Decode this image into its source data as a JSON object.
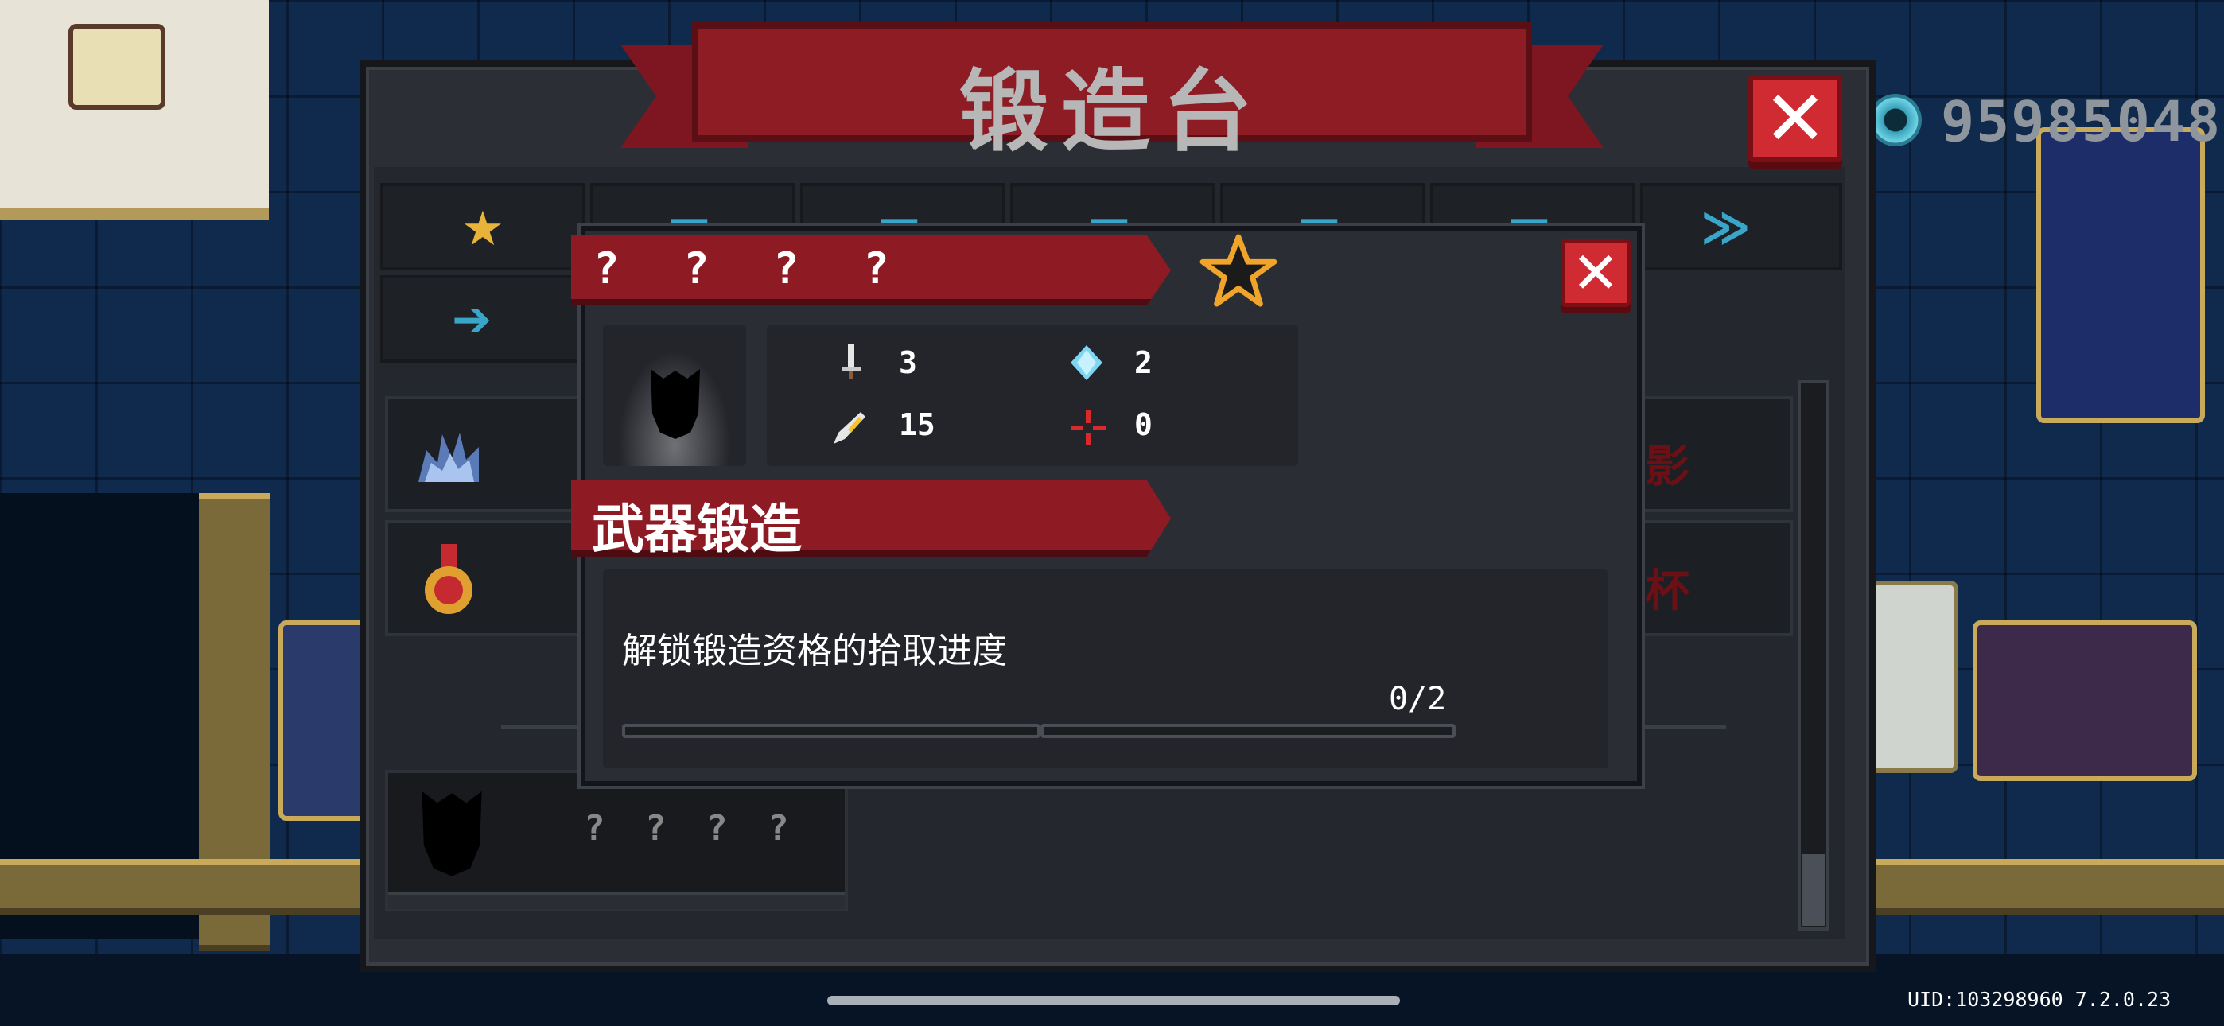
{
  "forge": {
    "title": "锻造台"
  },
  "currency": {
    "icon": "gem-coin-icon",
    "amount": "95985048",
    "color": "#8f959c"
  },
  "tabs": [
    {
      "icon": "star-icon",
      "color": "#e8b33a"
    },
    {
      "icon": "gun-icon",
      "color": "#39a6c9"
    },
    {
      "icon": "gun-icon",
      "color": "#39a6c9"
    },
    {
      "icon": "gun-icon",
      "color": "#39a6c9"
    },
    {
      "icon": "gun-icon",
      "color": "#39a6c9"
    },
    {
      "icon": "gun-icon",
      "color": "#39a6c9"
    },
    {
      "icon": "gun-icon",
      "color": "#39a6c9"
    },
    {
      "icon": "arrow-gun-icon",
      "color": "#39a6c9"
    }
  ],
  "list": {
    "rows": [
      {
        "icon": "spiked-shell-icon",
        "right_text": "影"
      },
      {
        "icon": "medal-icon",
        "right_text": "杯"
      }
    ],
    "unknown_card": {
      "name": "? ? ? ?"
    }
  },
  "detail": {
    "name": "? ? ? ?",
    "rarity": "star-outline-icon",
    "stats": {
      "attack": "3",
      "energy": "2",
      "crit": "15",
      "accuracy": "0"
    },
    "section_title": "武器锻造",
    "requirement": {
      "label": "解锁锻造资格的拾取进度",
      "progress_text": "0/2",
      "current": 0,
      "total": 2
    }
  },
  "footer": {
    "uid": "UID:103298960 7.2.0.23"
  },
  "colors": {
    "accent_red": "#8e1b24",
    "close_red": "#d02a32",
    "panel": "#2a2d34"
  }
}
